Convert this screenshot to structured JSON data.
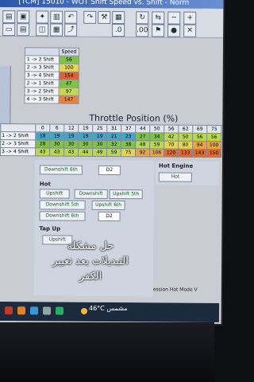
{
  "window": {
    "title": "[TCM] 15010 - WOT Shift Speed vs. Shift - Norm"
  },
  "shift_table": {
    "header": "Speed",
    "rows": [
      {
        "label": "1 -> 2 Shift",
        "value": "56",
        "color": "#7fc342"
      },
      {
        "label": "2 -> 3 Shift",
        "value": "100",
        "color": "#e8d64a"
      },
      {
        "label": "3 -> 4 Shift",
        "value": "154",
        "color": "#e0602f"
      },
      {
        "label": "2 -> 1 Shift",
        "value": "47",
        "color": "#7fc342"
      },
      {
        "label": "3 -> 2 Shift",
        "value": "97",
        "color": "#c7d94a"
      },
      {
        "label": "4 -> 3 Shift",
        "value": "147",
        "color": "#e6823a"
      }
    ]
  },
  "throttle": {
    "title": "Throttle Position (%)",
    "columns": [
      "0",
      "6",
      "12",
      "19",
      "25",
      "31",
      "37",
      "44",
      "50",
      "56",
      "62",
      "69",
      "75"
    ],
    "rows": [
      {
        "label": "1 -> 2 Shift",
        "values": [
          "18",
          "19",
          "19",
          "19",
          "19",
          "21",
          "23",
          "27",
          "34",
          "42",
          "50",
          "56",
          "56"
        ]
      },
      {
        "label": "2 -> 3 Shift",
        "values": [
          "28",
          "30",
          "30",
          "30",
          "30",
          "32",
          "38",
          "48",
          "59",
          "70",
          "80",
          "94",
          "100"
        ]
      },
      {
        "label": "3 -> 4 Shift",
        "values": [
          "43",
          "43",
          "43",
          "44",
          "49",
          "59",
          "75",
          "92",
          "106",
          "120",
          "133",
          "143",
          "150"
        ]
      }
    ]
  },
  "controls": {
    "downshift_6th": "Downshift 6th",
    "d2": "D2",
    "hot": "Hot",
    "upshift": "Upshift",
    "downshift": "Downshift",
    "upshift_5th": "Upshift 5th",
    "downshift_5th": "Downshift 5th",
    "upshift_6th": "Upshift 6th",
    "downshift_6th_b": "Downshift 6th",
    "d2_b": "D2",
    "tap_up": "Tap Up",
    "upshift_b": "Upshift",
    "hot_engine": "Hot Engine",
    "hot_b": "Hot",
    "partial_label": "ession Hot Mode V"
  },
  "caption": {
    "line1": "حل مشكلة",
    "line2": "التبديلات بعد تغيير",
    "line3": "الكفر"
  },
  "taskbar": {
    "temperature": "46°C",
    "weather": "مشمس"
  }
}
